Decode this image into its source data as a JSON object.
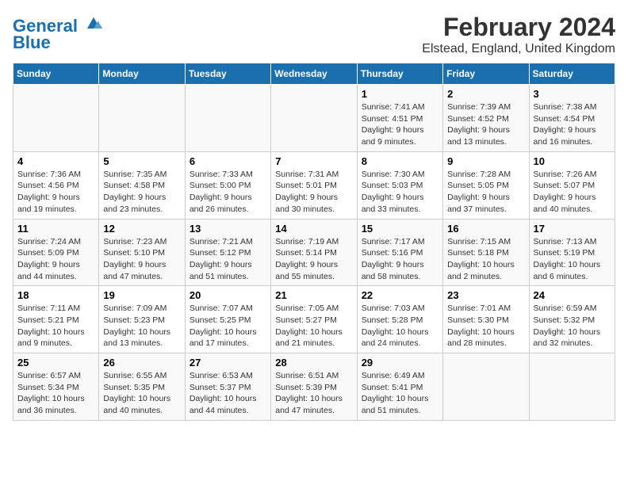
{
  "header": {
    "logo_line1": "General",
    "logo_line2": "Blue",
    "title": "February 2024",
    "subtitle": "Elstead, England, United Kingdom"
  },
  "columns": [
    "Sunday",
    "Monday",
    "Tuesday",
    "Wednesday",
    "Thursday",
    "Friday",
    "Saturday"
  ],
  "weeks": [
    [
      {
        "day": "",
        "info": ""
      },
      {
        "day": "",
        "info": ""
      },
      {
        "day": "",
        "info": ""
      },
      {
        "day": "",
        "info": ""
      },
      {
        "day": "1",
        "info": "Sunrise: 7:41 AM\nSunset: 4:51 PM\nDaylight: 9 hours\nand 9 minutes."
      },
      {
        "day": "2",
        "info": "Sunrise: 7:39 AM\nSunset: 4:52 PM\nDaylight: 9 hours\nand 13 minutes."
      },
      {
        "day": "3",
        "info": "Sunrise: 7:38 AM\nSunset: 4:54 PM\nDaylight: 9 hours\nand 16 minutes."
      }
    ],
    [
      {
        "day": "4",
        "info": "Sunrise: 7:36 AM\nSunset: 4:56 PM\nDaylight: 9 hours\nand 19 minutes."
      },
      {
        "day": "5",
        "info": "Sunrise: 7:35 AM\nSunset: 4:58 PM\nDaylight: 9 hours\nand 23 minutes."
      },
      {
        "day": "6",
        "info": "Sunrise: 7:33 AM\nSunset: 5:00 PM\nDaylight: 9 hours\nand 26 minutes."
      },
      {
        "day": "7",
        "info": "Sunrise: 7:31 AM\nSunset: 5:01 PM\nDaylight: 9 hours\nand 30 minutes."
      },
      {
        "day": "8",
        "info": "Sunrise: 7:30 AM\nSunset: 5:03 PM\nDaylight: 9 hours\nand 33 minutes."
      },
      {
        "day": "9",
        "info": "Sunrise: 7:28 AM\nSunset: 5:05 PM\nDaylight: 9 hours\nand 37 minutes."
      },
      {
        "day": "10",
        "info": "Sunrise: 7:26 AM\nSunset: 5:07 PM\nDaylight: 9 hours\nand 40 minutes."
      }
    ],
    [
      {
        "day": "11",
        "info": "Sunrise: 7:24 AM\nSunset: 5:09 PM\nDaylight: 9 hours\nand 44 minutes."
      },
      {
        "day": "12",
        "info": "Sunrise: 7:23 AM\nSunset: 5:10 PM\nDaylight: 9 hours\nand 47 minutes."
      },
      {
        "day": "13",
        "info": "Sunrise: 7:21 AM\nSunset: 5:12 PM\nDaylight: 9 hours\nand 51 minutes."
      },
      {
        "day": "14",
        "info": "Sunrise: 7:19 AM\nSunset: 5:14 PM\nDaylight: 9 hours\nand 55 minutes."
      },
      {
        "day": "15",
        "info": "Sunrise: 7:17 AM\nSunset: 5:16 PM\nDaylight: 9 hours\nand 58 minutes."
      },
      {
        "day": "16",
        "info": "Sunrise: 7:15 AM\nSunset: 5:18 PM\nDaylight: 10 hours\nand 2 minutes."
      },
      {
        "day": "17",
        "info": "Sunrise: 7:13 AM\nSunset: 5:19 PM\nDaylight: 10 hours\nand 6 minutes."
      }
    ],
    [
      {
        "day": "18",
        "info": "Sunrise: 7:11 AM\nSunset: 5:21 PM\nDaylight: 10 hours\nand 9 minutes."
      },
      {
        "day": "19",
        "info": "Sunrise: 7:09 AM\nSunset: 5:23 PM\nDaylight: 10 hours\nand 13 minutes."
      },
      {
        "day": "20",
        "info": "Sunrise: 7:07 AM\nSunset: 5:25 PM\nDaylight: 10 hours\nand 17 minutes."
      },
      {
        "day": "21",
        "info": "Sunrise: 7:05 AM\nSunset: 5:27 PM\nDaylight: 10 hours\nand 21 minutes."
      },
      {
        "day": "22",
        "info": "Sunrise: 7:03 AM\nSunset: 5:28 PM\nDaylight: 10 hours\nand 24 minutes."
      },
      {
        "day": "23",
        "info": "Sunrise: 7:01 AM\nSunset: 5:30 PM\nDaylight: 10 hours\nand 28 minutes."
      },
      {
        "day": "24",
        "info": "Sunrise: 6:59 AM\nSunset: 5:32 PM\nDaylight: 10 hours\nand 32 minutes."
      }
    ],
    [
      {
        "day": "25",
        "info": "Sunrise: 6:57 AM\nSunset: 5:34 PM\nDaylight: 10 hours\nand 36 minutes."
      },
      {
        "day": "26",
        "info": "Sunrise: 6:55 AM\nSunset: 5:35 PM\nDaylight: 10 hours\nand 40 minutes."
      },
      {
        "day": "27",
        "info": "Sunrise: 6:53 AM\nSunset: 5:37 PM\nDaylight: 10 hours\nand 44 minutes."
      },
      {
        "day": "28",
        "info": "Sunrise: 6:51 AM\nSunset: 5:39 PM\nDaylight: 10 hours\nand 47 minutes."
      },
      {
        "day": "29",
        "info": "Sunrise: 6:49 AM\nSunset: 5:41 PM\nDaylight: 10 hours\nand 51 minutes."
      },
      {
        "day": "",
        "info": ""
      },
      {
        "day": "",
        "info": ""
      }
    ]
  ]
}
